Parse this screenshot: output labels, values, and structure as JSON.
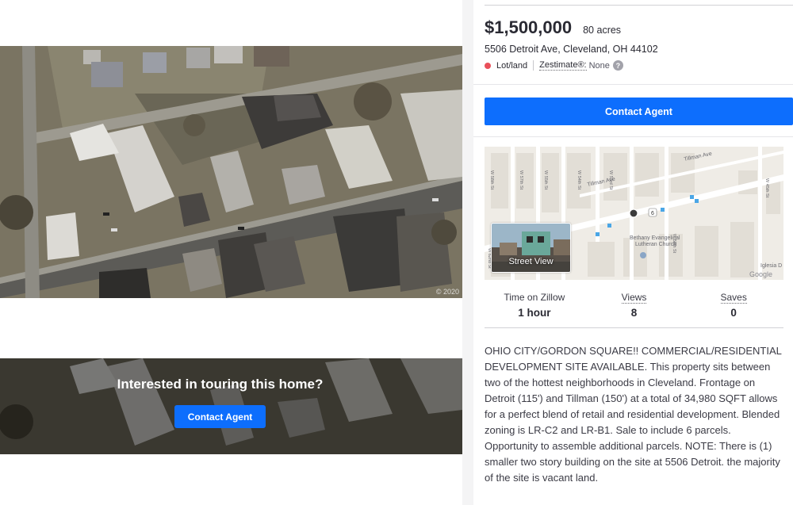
{
  "photo": {
    "copyright": "© 2020"
  },
  "tour": {
    "title": "Interested in touring this home?",
    "button_label": "Contact Agent"
  },
  "listing": {
    "price": "$1,500,000",
    "size": "80 acres",
    "address": "5506 Detroit Ave, Cleveland, OH 44102",
    "status": "Lot/land",
    "zestimate_label": "Zestimate®:",
    "zestimate_value": "None",
    "help_glyph": "?",
    "status_color": "#e9505a"
  },
  "contact": {
    "label": "Contact Agent",
    "color": "#0d6efd"
  },
  "map": {
    "street_view_label": "Street View",
    "labels": {
      "tillman_ave": "Tillman Ave",
      "tillman_ave_2": "Tillman Ave",
      "church": "Bethany Evangelical Lutheran Church",
      "church_2": "Iglesia D",
      "google": "Google",
      "w58": "W 58th St",
      "w57": "W 57th St",
      "w54": "W 54th St",
      "w53": "W 53rd St",
      "w55": "W 55th St",
      "w45": "W 45th St",
      "w62": "W 62nd St",
      "w50": "W 50th St",
      "route_shield": "6"
    }
  },
  "stats": [
    {
      "label": "Time on Zillow",
      "value": "1 hour"
    },
    {
      "label": "Views",
      "value": "8"
    },
    {
      "label": "Saves",
      "value": "0"
    }
  ],
  "description": "OHIO CITY/GORDON SQUARE!! COMMERCIAL/RESIDENTIAL DEVELOPMENT SITE AVAILABLE. This property sits between two of the hottest neighborhoods in Cleveland. Frontage on Detroit (115') and Tillman (150') at a total of 34,980 SQFT allows for a perfect blend of retail and residential development. Blended zoning is LR-C2 and LR-B1. Sale to include 6 parcels. Opportunity to assemble additional parcels. NOTE: There is (1) smaller two story building on the site at 5506 Detroit. the majority of the site is vacant land."
}
